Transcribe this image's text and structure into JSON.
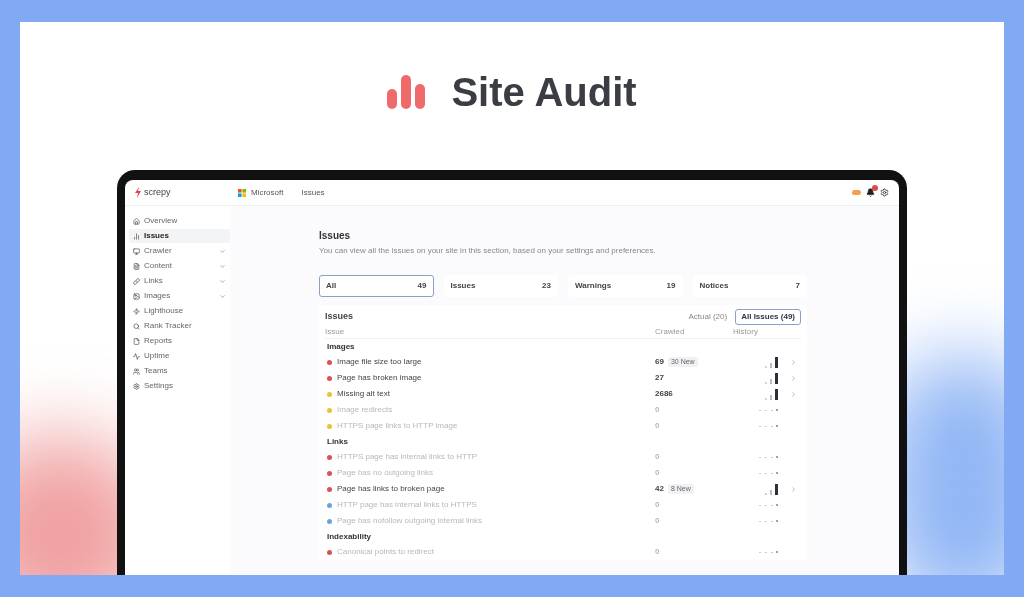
{
  "hero": {
    "title": "Site Audit"
  },
  "app": {
    "logo": "screpy",
    "breadcrumb": [
      "Microsoft",
      "Issues"
    ]
  },
  "sidebar": {
    "items": [
      {
        "label": "Overview",
        "selected": false,
        "has_submenu": false
      },
      {
        "label": "Issues",
        "selected": true,
        "has_submenu": false
      },
      {
        "label": "Crawler",
        "selected": false,
        "has_submenu": true
      },
      {
        "label": "Content",
        "selected": false,
        "has_submenu": true
      },
      {
        "label": "Links",
        "selected": false,
        "has_submenu": true
      },
      {
        "label": "Images",
        "selected": false,
        "has_submenu": true
      },
      {
        "label": "Lighthouse",
        "selected": false,
        "has_submenu": false
      },
      {
        "label": "Rank Tracker",
        "selected": false,
        "has_submenu": false
      },
      {
        "label": "Reports",
        "selected": false,
        "has_submenu": false
      },
      {
        "label": "Uptime",
        "selected": false,
        "has_submenu": false
      },
      {
        "label": "Teams",
        "selected": false,
        "has_submenu": false
      },
      {
        "label": "Settings",
        "selected": false,
        "has_submenu": false
      }
    ]
  },
  "page": {
    "title": "Issues",
    "subtitle": "You can view all the issues on your site in this section, based on your settings and preferences."
  },
  "tabs": [
    {
      "label": "All",
      "count": "49",
      "selected": true
    },
    {
      "label": "Issues",
      "count": "23",
      "selected": false
    },
    {
      "label": "Warnings",
      "count": "19",
      "selected": false
    },
    {
      "label": "Notices",
      "count": "7",
      "selected": false
    }
  ],
  "table": {
    "title": "Issues",
    "filters": [
      {
        "label": "Actual (20)",
        "selected": false
      },
      {
        "label": "All Issues (49)",
        "selected": true
      }
    ],
    "columns": [
      "Issue",
      "Crawled",
      "History"
    ],
    "groups": [
      {
        "name": "Images",
        "rows": [
          {
            "issue": "Image file size too large",
            "crawled": "69",
            "badge": "30 New",
            "color": "#d9534f",
            "muted": false
          },
          {
            "issue": "Page has broken image",
            "crawled": "27",
            "color": "#d9534f",
            "muted": false
          },
          {
            "issue": "Missing alt text",
            "crawled": "2686",
            "color": "#e6c13c",
            "muted": false
          },
          {
            "issue": "Image redirects",
            "crawled": "0",
            "color": "#e6c13c",
            "muted": true
          },
          {
            "issue": "HTTPS page links to HTTP image",
            "crawled": "0",
            "color": "#e6c13c",
            "muted": true
          }
        ]
      },
      {
        "name": "Links",
        "rows": [
          {
            "issue": "HTTPS page has internal links to HTTP",
            "crawled": "0",
            "color": "#d9534f",
            "muted": true
          },
          {
            "issue": "Page has no outgoing links",
            "crawled": "0",
            "color": "#d9534f",
            "muted": true
          },
          {
            "issue": "Page has links to broken page",
            "crawled": "42",
            "badge": "8 New",
            "color": "#d9534f",
            "muted": false
          },
          {
            "issue": "HTTP page has internal links to HTTPS",
            "crawled": "0",
            "color": "#6fa3d8",
            "muted": true
          },
          {
            "issue": "Page has nofollow outgoing internal links",
            "crawled": "0",
            "color": "#6fa3d8",
            "muted": true
          }
        ]
      },
      {
        "name": "Indexability",
        "rows": [
          {
            "issue": "Canonical points to redirect",
            "crawled": "0",
            "color": "#d9534f",
            "muted": true
          }
        ]
      }
    ]
  }
}
